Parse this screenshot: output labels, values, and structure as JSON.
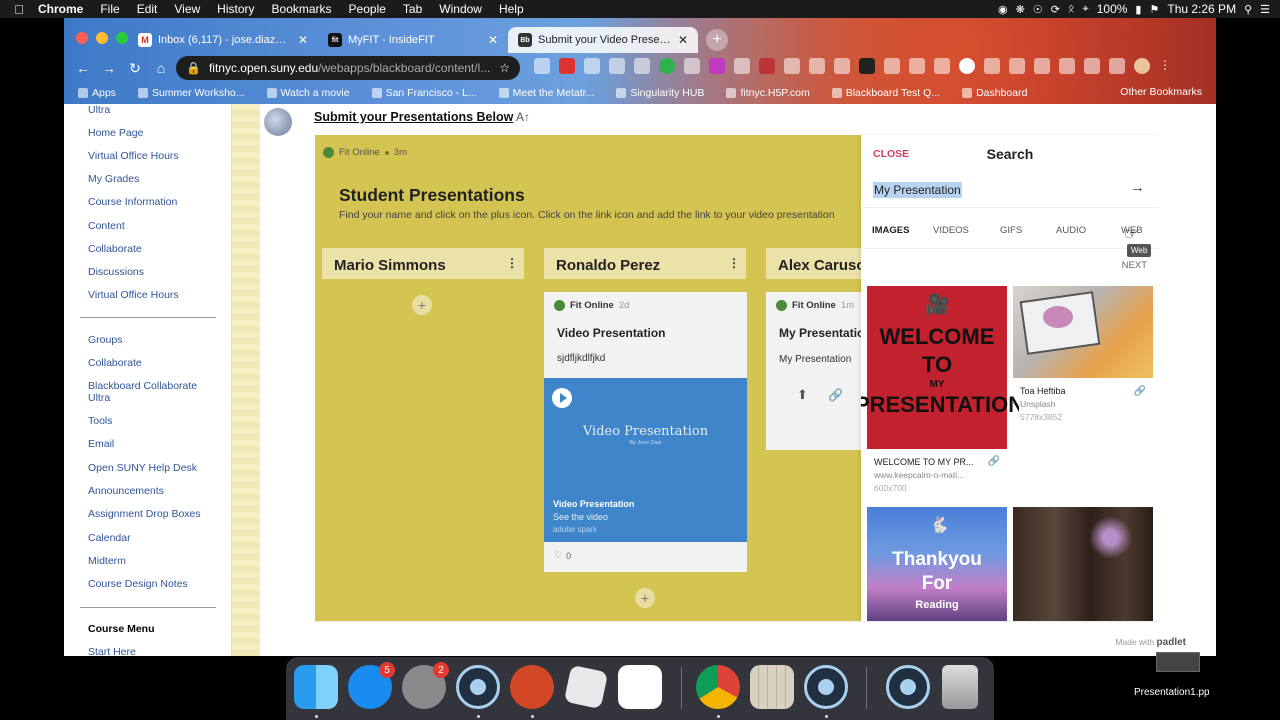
{
  "menubar": {
    "app": "Chrome",
    "items": [
      "File",
      "Edit",
      "View",
      "History",
      "Bookmarks",
      "People",
      "Tab",
      "Window",
      "Help"
    ],
    "battery": "100%",
    "clock": "Thu 2:26 PM"
  },
  "browser": {
    "tabs": [
      {
        "icon": "M",
        "title": "Inbox (6,117) - jose.diaz1@fitnyc.edu",
        "active": false
      },
      {
        "icon": "fit",
        "title": "MyFIT - InsideFIT",
        "active": false
      },
      {
        "icon": "Bb",
        "title": "Submit your Video Presentation",
        "active": true
      }
    ],
    "url_host": "fitnyc.open.suny.edu",
    "url_path": "/webapps/blackboard/content/l...",
    "bookmarks": [
      "Apps",
      "Summer Worksho...",
      "Watch a movie",
      "San Francisco - L...",
      "Meet the Metatr...",
      "Singularity HUB",
      "fitnyc.H5P.com",
      "Blackboard Test Q...",
      "Dashboard"
    ],
    "other_bookmarks": "Other Bookmarks"
  },
  "leftnav": {
    "top_items": [
      "Ultra",
      "Home Page",
      "Virtual Office Hours",
      "My Grades",
      "Course Information",
      "Content",
      "Collaborate",
      "Discussions",
      "Virtual Office Hours"
    ],
    "bottom_items": [
      "Groups",
      "Collaborate",
      "Blackboard Collaborate",
      "Ultra",
      "Tools",
      "Email",
      "Open SUNY Help Desk",
      "Announcements",
      "Assignment Drop Boxes",
      "Calendar",
      "Midterm",
      "Course Design Notes"
    ],
    "section_heading": "Course Menu",
    "last_item": "Start Here"
  },
  "content": {
    "item_title": "Submit your Presentations Below",
    "item_extra": "A↑"
  },
  "padlet": {
    "owner": "Fit Online",
    "age": "3m",
    "title": "Student Presentations",
    "description": "Find your name and click on the plus icon. Click on the link icon and add the link to your video presentation",
    "columns": [
      "Mario Simmons",
      "Ronaldo Perez",
      "Alex Caruso"
    ],
    "post_ronaldo": {
      "author": "Fit Online",
      "age": "2d",
      "title": "Video Presentation",
      "body": "sjdfljkdlfjkd",
      "attachment_main": "Video Presentation",
      "attachment_sub": "By Jose Diaz",
      "attachment_title": "Video Presentation",
      "attachment_desc": "See the video",
      "attachment_source": "adobe spark",
      "likes": "0"
    },
    "post_alex": {
      "author": "Fit Online",
      "age": "1m",
      "title": "My Presentation",
      "body": "My Presentation"
    },
    "made_with": "Made with",
    "brand": "padlet"
  },
  "search": {
    "close": "CLOSE",
    "title": "Search",
    "query": "My Presentation",
    "tabs": [
      "IMAGES",
      "VIDEOS",
      "GIFS",
      "AUDIO",
      "WEB"
    ],
    "active_tab": "IMAGES",
    "tooltip": "Web",
    "next": "NEXT",
    "results": [
      {
        "caption": "WELCOME TO MY PR...",
        "source": "www.keepcalm-o-mati...",
        "size": "600x700",
        "img_text": [
          "WELCOME",
          "TO",
          "MY",
          "PRESENTATION"
        ]
      },
      {
        "caption": "Toa Heftiba",
        "source": "Unsplash",
        "size": "5778x3852"
      },
      {
        "img_text": [
          "Thankyou",
          "For",
          "Reading"
        ]
      },
      {}
    ]
  },
  "dock": {
    "appstore_badge": "5",
    "settings_badge": "2",
    "file_label": "Presentation1.pp"
  },
  "colors": {
    "padlet_bg": "#d4c451",
    "close_accent": "#d0425f",
    "nav_link": "#2f5597"
  }
}
